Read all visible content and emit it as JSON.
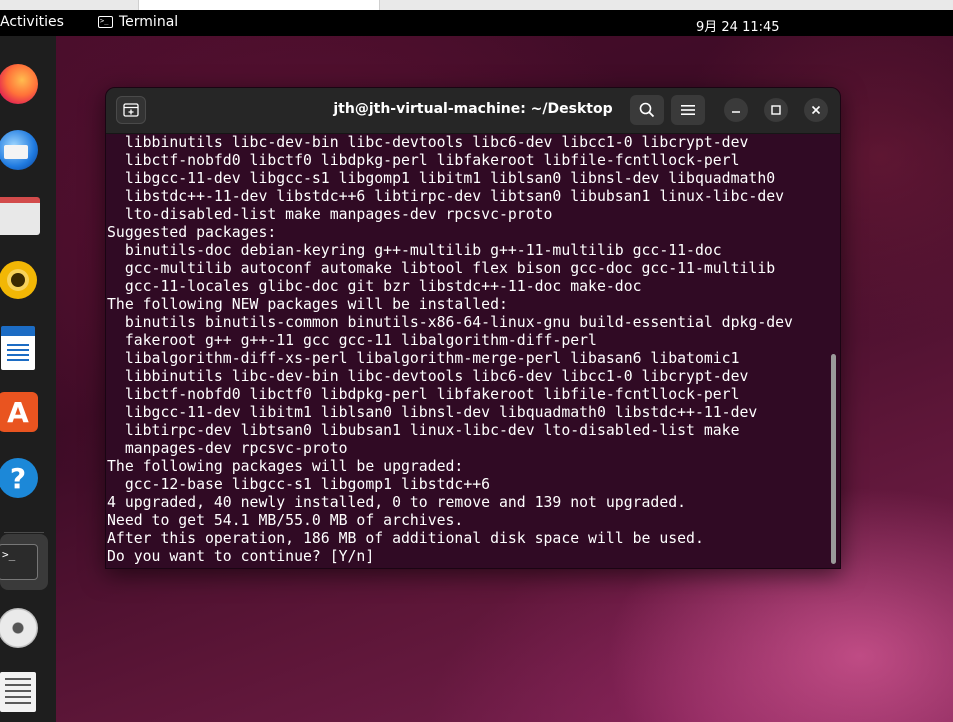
{
  "topbar": {
    "activities_label": "Activities",
    "app_name": "Terminal",
    "clock": "9月 24  11:45"
  },
  "dock": {
    "items": [
      "firefox-icon",
      "thunderbird-icon",
      "files-icon",
      "rhythmbox-icon",
      "writer-icon",
      "software-icon",
      "help-icon",
      "terminal-icon",
      "disc-icon",
      "text-editor-icon"
    ],
    "help_glyph": "?",
    "software_glyph": "A",
    "terminal_glyph": ">_"
  },
  "window": {
    "title": "jth@jth-virtual-machine: ~/Desktop",
    "background": "#300a24",
    "lines": [
      "  libbinutils libc-dev-bin libc-devtools libc6-dev libcc1-0 libcrypt-dev",
      "  libctf-nobfd0 libctf0 libdpkg-perl libfakeroot libfile-fcntllock-perl",
      "  libgcc-11-dev libgcc-s1 libgomp1 libitm1 liblsan0 libnsl-dev libquadmath0",
      "  libstdc++-11-dev libstdc++6 libtirpc-dev libtsan0 libubsan1 linux-libc-dev",
      "  lto-disabled-list make manpages-dev rpcsvc-proto",
      "Suggested packages:",
      "  binutils-doc debian-keyring g++-multilib g++-11-multilib gcc-11-doc",
      "  gcc-multilib autoconf automake libtool flex bison gcc-doc gcc-11-multilib",
      "  gcc-11-locales glibc-doc git bzr libstdc++-11-doc make-doc",
      "The following NEW packages will be installed:",
      "  binutils binutils-common binutils-x86-64-linux-gnu build-essential dpkg-dev",
      "  fakeroot g++ g++-11 gcc gcc-11 libalgorithm-diff-perl",
      "  libalgorithm-diff-xs-perl libalgorithm-merge-perl libasan6 libatomic1",
      "  libbinutils libc-dev-bin libc-devtools libc6-dev libcc1-0 libcrypt-dev",
      "  libctf-nobfd0 libctf0 libdpkg-perl libfakeroot libfile-fcntllock-perl",
      "  libgcc-11-dev libitm1 liblsan0 libnsl-dev libquadmath0 libstdc++-11-dev",
      "  libtirpc-dev libtsan0 libubsan1 linux-libc-dev lto-disabled-list make",
      "  manpages-dev rpcsvc-proto",
      "The following packages will be upgraded:",
      "  gcc-12-base libgcc-s1 libgomp1 libstdc++6",
      "4 upgraded, 40 newly installed, 0 to remove and 139 not upgraded.",
      "Need to get 54.1 MB/55.0 MB of archives.",
      "After this operation, 186 MB of additional disk space will be used.",
      "Do you want to continue? [Y/n] "
    ]
  }
}
